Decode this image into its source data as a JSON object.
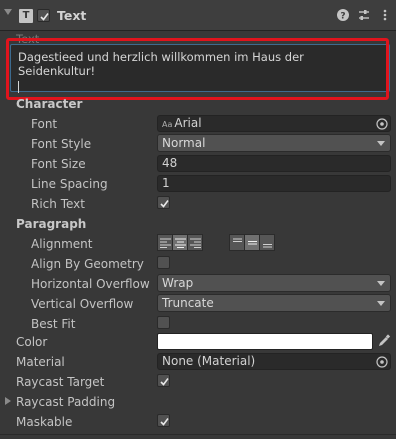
{
  "header": {
    "title": "Text",
    "enabled": true
  },
  "text_area": {
    "label": "Text",
    "value": "Dagestieed und herzlich willkommen im Haus der Seidenkultur!"
  },
  "sections": {
    "character": "Character",
    "paragraph": "Paragraph"
  },
  "fields": {
    "font": {
      "label": "Font",
      "value": "Arial",
      "badge": "Aa"
    },
    "font_style": {
      "label": "Font Style",
      "value": "Normal"
    },
    "font_size": {
      "label": "Font Size",
      "value": "48"
    },
    "line_spacing": {
      "label": "Line Spacing",
      "value": "1"
    },
    "rich_text": {
      "label": "Rich Text",
      "checked": true
    },
    "alignment": {
      "label": "Alignment",
      "horizontal": "center",
      "vertical": "middle"
    },
    "align_by_geometry": {
      "label": "Align By Geometry",
      "checked": false
    },
    "horizontal_overflow": {
      "label": "Horizontal Overflow",
      "value": "Wrap"
    },
    "vertical_overflow": {
      "label": "Vertical Overflow",
      "value": "Truncate"
    },
    "best_fit": {
      "label": "Best Fit",
      "checked": false
    },
    "color": {
      "label": "Color",
      "value": "#ffffff"
    },
    "material": {
      "label": "Material",
      "value": "None (Material)"
    },
    "raycast_target": {
      "label": "Raycast Target",
      "checked": true
    },
    "raycast_padding": {
      "label": "Raycast Padding"
    },
    "maskable": {
      "label": "Maskable",
      "checked": true
    }
  },
  "icons": {
    "fold": "chevron-down-icon",
    "component": "text-component-icon",
    "help": "help-icon",
    "presets": "presets-icon",
    "menu": "kebab-menu-icon"
  },
  "colors": {
    "accent_border": "#e0141d",
    "focus_border": "#3d6b8f"
  }
}
